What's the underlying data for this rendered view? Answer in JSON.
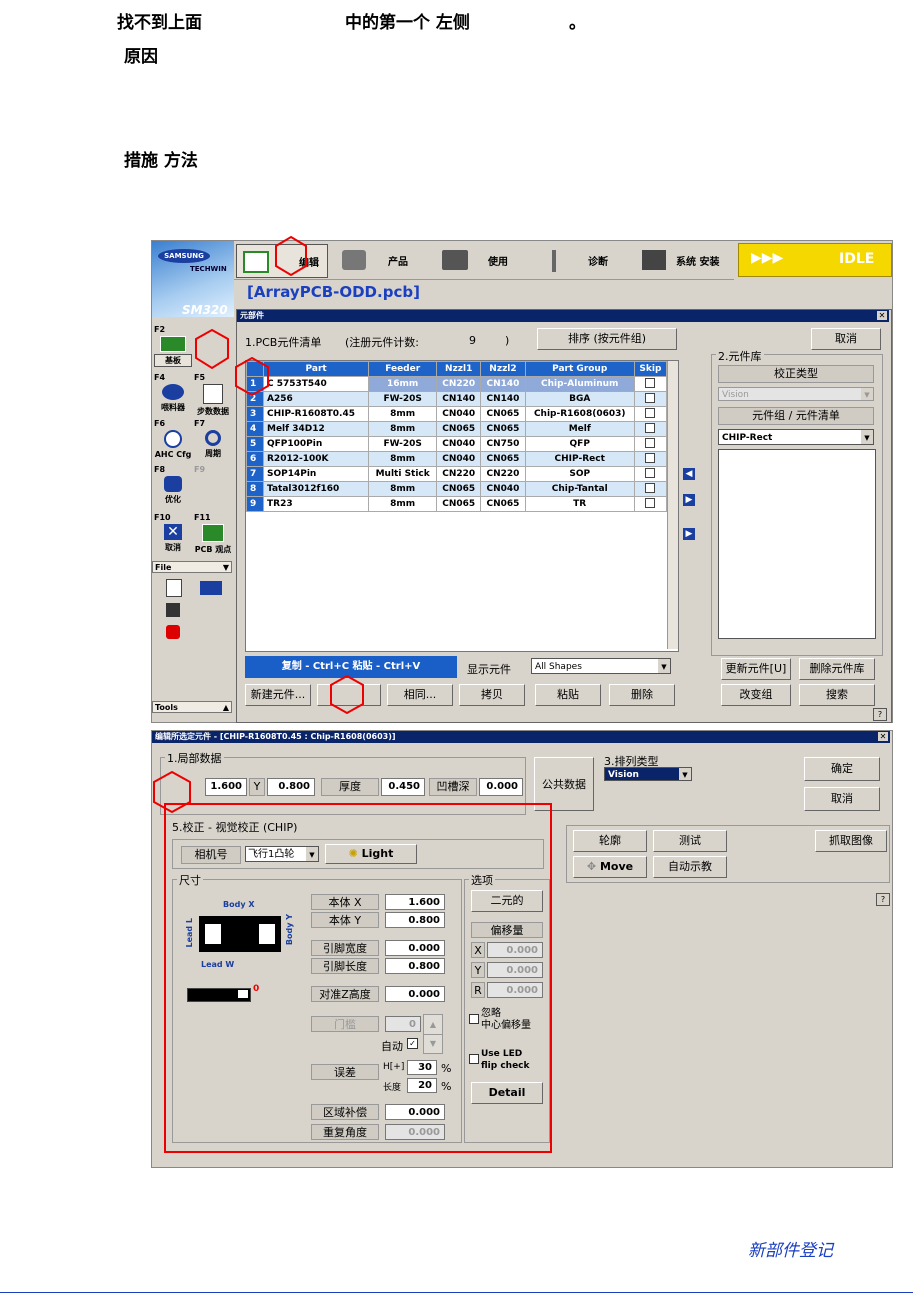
{
  "doc": {
    "line1_a": "找不到上面",
    "line1_b": "中的第一个 左侧",
    "line1_c": "。",
    "line2": "原因",
    "line3": "措施 方法",
    "footer": "新部件登记"
  },
  "app": {
    "logo_top": "SAMSUNG",
    "logo_sub": "TECHWIN",
    "model": "SM320",
    "nav": [
      {
        "label": "编辑"
      },
      {
        "label": "产品"
      },
      {
        "label": "使用"
      },
      {
        "label": "诊断"
      },
      {
        "label": "系统 安装"
      }
    ],
    "status": "IDLE",
    "status_arrows": "▶▶▶",
    "file_title": "[ArrayPCB-ODD.pcb]",
    "side": {
      "f2": "F2",
      "f2_label": "基板",
      "f4": "F4",
      "f4_label": "喂料器",
      "f5": "F5",
      "f5_label": "步数数据",
      "f6": "F6",
      "f6_label": "AHC Cfg",
      "f7": "F7",
      "f7_label": "周期",
      "f8": "F8",
      "f8_label": "优化",
      "f9": "F9",
      "f10": "F10",
      "f10_label": "取消",
      "f11": "F11",
      "f11_label": "PCB 观点",
      "file_menu": "File",
      "tools_menu": "Tools"
    }
  },
  "parts_window": {
    "title": "元部件",
    "list_title": "1.PCB元件清单",
    "reg_count_label": "(注册元件计数:",
    "reg_count": "9",
    "reg_close": ")",
    "sort_button": "排序 (按元件组)",
    "cancel_button": "取消",
    "columns": [
      "Part",
      "Feeder",
      "Nzzl1",
      "Nzzl2",
      "Part Group",
      "Skip"
    ],
    "rows": [
      {
        "n": "1",
        "part": "C 5753T540",
        "feeder": "16mm",
        "n1": "CN220",
        "n2": "CN140",
        "group": "Chip-Aluminum"
      },
      {
        "n": "2",
        "part": "A256",
        "feeder": "FW-20S",
        "n1": "CN140",
        "n2": "CN140",
        "group": "BGA"
      },
      {
        "n": "3",
        "part": "CHIP-R1608T0.45",
        "feeder": "8mm",
        "n1": "CN040",
        "n2": "CN065",
        "group": "Chip-R1608(0603)"
      },
      {
        "n": "4",
        "part": "Melf 34D12",
        "feeder": "8mm",
        "n1": "CN065",
        "n2": "CN065",
        "group": "Melf"
      },
      {
        "n": "5",
        "part": "QFP100Pin",
        "feeder": "FW-20S",
        "n1": "CN040",
        "n2": "CN750",
        "group": "QFP"
      },
      {
        "n": "6",
        "part": "R2012-100K",
        "feeder": "8mm",
        "n1": "CN040",
        "n2": "CN065",
        "group": "CHIP-Rect"
      },
      {
        "n": "7",
        "part": "SOP14Pin",
        "feeder": "Multi Stick",
        "n1": "CN220",
        "n2": "CN220",
        "group": "SOP"
      },
      {
        "n": "8",
        "part": "Tatal3012f160",
        "feeder": "8mm",
        "n1": "CN065",
        "n2": "CN040",
        "group": "Chip-Tantal"
      },
      {
        "n": "9",
        "part": "TR23",
        "feeder": "8mm",
        "n1": "CN065",
        "n2": "CN065",
        "group": "TR"
      }
    ],
    "copy_paste_bar": "复制 - Ctrl+C  粘贴 - Ctrl+V",
    "show_parts_label": "显示元件",
    "show_parts_value": "All Shapes",
    "btn_new": "新建元件...",
    "btn_same": "相同...",
    "btn_copy": "拷贝",
    "btn_paste": "粘贴",
    "btn_delete": "删除",
    "lib_title": "2.元件库",
    "calib_type": "校正类型",
    "vision": "Vision",
    "group_list": "元件组 / 元件清单",
    "group_value": "CHIP-Rect",
    "btn_update": "更新元件[U]",
    "btn_remove_lib": "删除元件库",
    "btn_change_group": "改变组",
    "btn_search": "搜索",
    "help": "?"
  },
  "edit_window": {
    "title": "编辑所选定元件 - [CHIP-R1608T0.45 : Chip-R1608(0603)]",
    "local_data": "1.局部数据",
    "x_val": "1.600",
    "y_label": "Y",
    "y_val": "0.800",
    "thick_label": "厚度",
    "thick_val": "0.450",
    "groove_label": "凹槽深",
    "groove_val": "0.000",
    "common_data": "公共数据",
    "arrange_type": "3.排列类型",
    "arrange_value": "Vision",
    "ok": "确定",
    "cancel": "取消",
    "calib_title": "5.校正 - 视觉校正 (CHIP)",
    "camera_label": "相机号",
    "camera_value": "飞行1凸轮",
    "light": "Light",
    "dim_title": "尺寸",
    "body_x_lbl": "Body X",
    "body_y_lbl": "Body Y",
    "lead_l_lbl": "Lead L",
    "lead_w_lbl": "Lead W",
    "body_x": "本体 X",
    "body_x_val": "1.600",
    "body_y": "本体 Y",
    "body_y_val": "0.800",
    "lead_width": "引脚宽度",
    "lead_width_val": "0.000",
    "lead_length": "引脚长度",
    "lead_length_val": "0.800",
    "align_z": "对准Z高度",
    "align_z_val": "0.000",
    "threshold": "门槛",
    "threshold_val": "0",
    "auto": "自动",
    "error": "误差",
    "w_label": "H[+]",
    "w_val": "30",
    "l_label": "长度",
    "l_val": "20",
    "pct": "%",
    "region_comp": "区域补偿",
    "region_val": "0.000",
    "repeat_angle": "重复角度",
    "repeat_val": "0.000",
    "options": "选项",
    "binary": "二元的",
    "offset": "偏移量",
    "off_x": "X",
    "off_x_val": "0.000",
    "off_y": "Y",
    "off_y_val": "0.000",
    "off_r": "R",
    "off_r_val": "0.000",
    "ignore_center": "忽略\n中心偏移量",
    "use_led": "Use LED\nflip check",
    "detail": "Detail",
    "outline": "轮廓",
    "test": "测试",
    "grab": "抓取图像",
    "move": "Move",
    "auto_teach": "自动示教",
    "help": "?",
    "zero_marker": "0"
  }
}
